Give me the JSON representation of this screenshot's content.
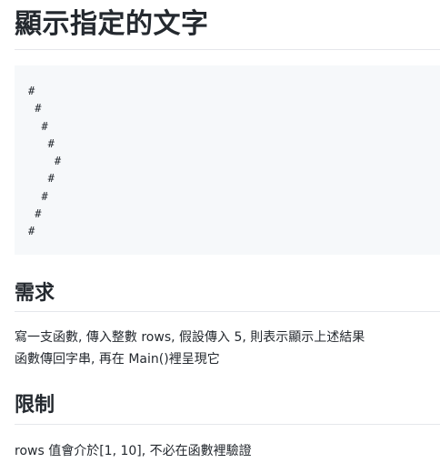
{
  "page": {
    "title": "顯示指定的文字",
    "code_block": "#\n #\n  #\n   #\n    #\n   #\n  #\n #\n#"
  },
  "sections": {
    "requirements": {
      "heading": "需求",
      "line1": "寫一支函數, 傳入整數 rows, 假設傳入 5, 則表示顯示上述結果",
      "line2": "函數傳回字串, 再在 Main()裡呈現它"
    },
    "limits": {
      "heading": "限制",
      "line1": "rows 值會介於[1, 10], 不必在函數裡驗證"
    }
  }
}
